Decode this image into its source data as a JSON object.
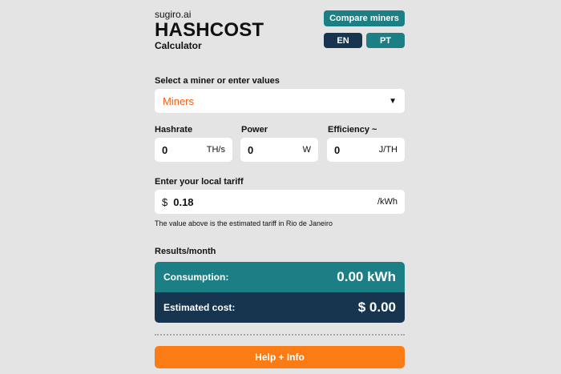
{
  "header": {
    "brand": "sugiro.ai",
    "title": "HASHCOST",
    "subtitle": "Calculator",
    "compare_label": "Compare miners",
    "lang_en": "EN",
    "lang_pt": "PT"
  },
  "miner_select": {
    "label": "Select a miner or enter values",
    "value": "Miners",
    "caret": "▼"
  },
  "hashrate": {
    "label": "Hashrate",
    "value": "0",
    "unit": "TH/s"
  },
  "power": {
    "label": "Power",
    "value": "0",
    "unit": "W"
  },
  "efficiency": {
    "label": "Efficiency ~",
    "value": "0",
    "unit": "J/TH"
  },
  "tariff": {
    "label": "Enter your local tariff",
    "currency": "$",
    "value": "0.18",
    "unit": "/kWh",
    "note": "The value above is the estimated tariff in Rio de Janeiro"
  },
  "results": {
    "label": "Results/month",
    "consumption_label": "Consumption:",
    "consumption_value": "0.00 kWh",
    "cost_label": "Estimated cost:",
    "cost_value": "$ 0.00"
  },
  "help_label": "Help + Info",
  "colors": {
    "teal": "#1c7f86",
    "navy": "#17354f",
    "orange": "#fb7c14",
    "accent_text": "#ef5f17",
    "background": "#e4e4e4"
  }
}
